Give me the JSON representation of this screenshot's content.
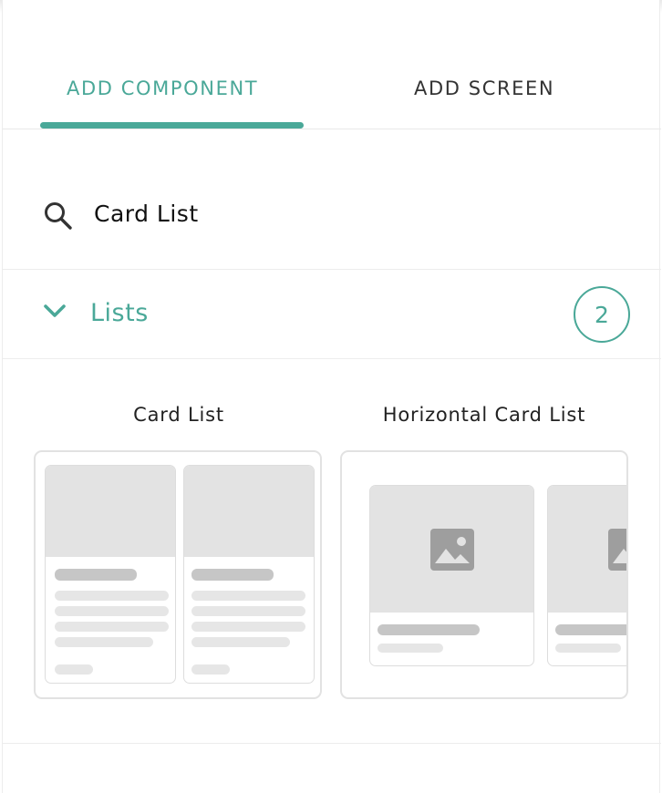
{
  "tabs": [
    {
      "label": "ADD COMPONENT",
      "active": true
    },
    {
      "label": "ADD SCREEN",
      "active": false
    }
  ],
  "search": {
    "value": "Card List",
    "icon": "search-icon"
  },
  "section": {
    "title": "Lists",
    "count": "2",
    "icon": "chevron-down-icon",
    "expanded": true
  },
  "items": [
    {
      "label": "Card List"
    },
    {
      "label": "Horizontal Card List"
    }
  ],
  "colors": {
    "accent": "#4aa898",
    "placeholder_dark": "#c6c6c6",
    "placeholder_light": "#e6e6e6",
    "image_fill": "#e3e3e3"
  }
}
